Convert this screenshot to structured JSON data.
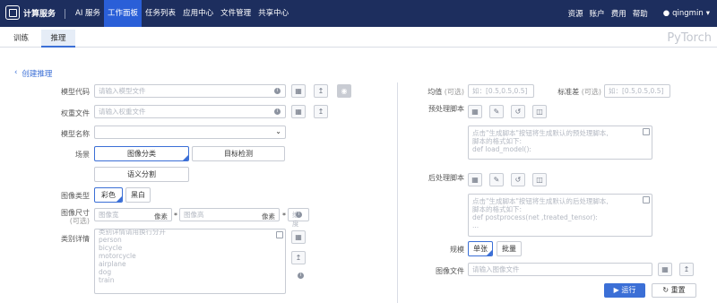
{
  "app": {
    "name": "计算服务"
  },
  "nav": {
    "items": [
      "AI 服务",
      "工作面板",
      "任务列表",
      "应用中心",
      "文件管理",
      "共享中心"
    ],
    "active": "工作面板"
  },
  "topright": {
    "items": [
      "资源",
      "账户",
      "费用",
      "帮助"
    ],
    "user": "qingmin"
  },
  "tabs": [
    "训练",
    "推理"
  ],
  "framework": "PyTorch",
  "back": "创建推理",
  "left": {
    "model_code": {
      "label": "模型代码",
      "placeholder": "请输入模型文件"
    },
    "weights": {
      "label": "权重文件",
      "placeholder": "请输入权重文件"
    },
    "model_name": {
      "label": "模型名称"
    },
    "scene": {
      "label": "场景",
      "options": [
        "图像分类",
        "目标检测",
        "语义分割"
      ],
      "selected": "图像分类"
    },
    "image_type": {
      "label": "图像类型",
      "options": [
        "彩色",
        "黑白"
      ],
      "selected": "彩色"
    },
    "image_size": {
      "label": "图像尺寸",
      "sublabel": "(可选)",
      "width_ph": "图像宽",
      "height_ph": "图像高",
      "channel_ph": "维度",
      "unit": "像素",
      "star": "*"
    },
    "categories": {
      "label": "类别详情",
      "lines": [
        "类别详情请用换行分开",
        "person",
        "bicycle",
        "motorcycle",
        "airplane",
        "dog",
        "train"
      ]
    }
  },
  "right": {
    "mean": {
      "label": "均值",
      "optional": "(可选)",
      "placeholder": "如：[0.5,0.5,0.5]"
    },
    "std": {
      "label": "标准差",
      "optional": "(可选)",
      "placeholder": "如：[0.5,0.5,0.5]"
    },
    "pre": {
      "label": "预处理脚本",
      "lines": [
        "点击\"生成脚本\"按钮将生成默认的预处理脚本,",
        "脚本的格式如下:",
        "def load_model():",
        "    ..."
      ]
    },
    "post": {
      "label": "后处理脚本",
      "lines": [
        "点击\"生成脚本\"按钮将生成默认的后处理脚本,",
        "脚本的格式如下:",
        "def postprocess(net ,treated_tensor):",
        "    ..."
      ]
    },
    "scale": {
      "label": "规模",
      "options": [
        "单张",
        "批量"
      ],
      "selected": "单张"
    },
    "image_file": {
      "label": "图像文件",
      "placeholder": "请输入图像文件"
    },
    "run": "运行",
    "reset": "重置"
  }
}
